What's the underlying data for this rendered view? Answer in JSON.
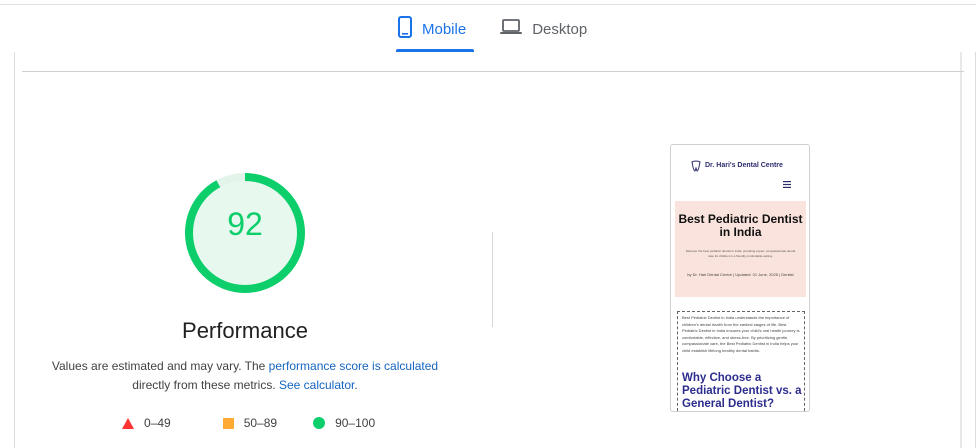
{
  "tabs": [
    {
      "label": "Mobile",
      "icon": "smartphone-icon",
      "active": true
    },
    {
      "label": "Desktop",
      "icon": "laptop-icon",
      "active": false
    }
  ],
  "performance": {
    "score": "92",
    "score_fraction": 0.92,
    "title": "Performance",
    "desc_prefix": "Values are estimated and may vary. The ",
    "link_score": "performance score is calculated",
    "desc_mid": "directly from these metrics. ",
    "link_calculator": "See calculator",
    "desc_suffix": "."
  },
  "legend": [
    {
      "label": "0–49",
      "shape": "triangle",
      "color": "#ff3333"
    },
    {
      "label": "50–89",
      "shape": "square",
      "color": "#ffaa33"
    },
    {
      "label": "90–100",
      "shape": "circle",
      "color": "#0cce6b"
    }
  ],
  "colors": {
    "accent": "#1a73e8",
    "pass": "#0cce6b",
    "gauge_bg": "#e7f8ee"
  },
  "preview": {
    "logo_text": "Dr. Hari's Dental Centre",
    "menu_icon": "hamburger-icon",
    "hero_title": "Best Pediatric Dentist in India",
    "hero_sub": "Discover the best pediatric dentist in India, providing expert, compassionate dental care for children in a friendly comfortable setting.",
    "hero_meta": "by Dr. Hari Dental Centre | Updated: 01 June, 2025 | Dentist",
    "body_text": "Best Pediatric Dentist in India understands the importance of children's dental health from the earliest stages of life. Best Pediatric Dentist in India ensures your child's oral health journey is comfortable, effective, and stress-free. By prioritizing gentle, compassionate care, the Best Pediatric Dentist in India helps your child establish lifelong healthy dental habits.",
    "body_heading": "Why Choose a Pediatric Dentist vs. a General Dentist?"
  }
}
